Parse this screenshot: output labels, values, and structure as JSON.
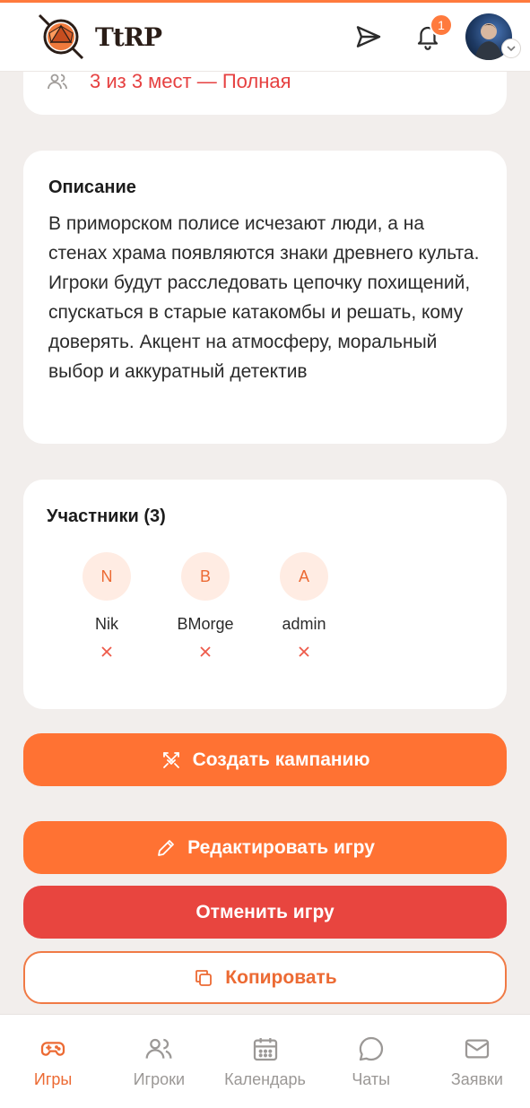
{
  "header": {
    "logo_text": "TtRP",
    "notifications_count": "1"
  },
  "seats": {
    "text": "3 из 3 мест — Полная"
  },
  "description": {
    "title": "Описание",
    "text": "В приморском полисе исчезают люди, а на стенах храма появляются знаки древнего культа. Игроки будут расследовать цепочку похищений, спускаться в старые катакомбы и решать, кому доверять. Акцент на атмосферу, моральный выбор и аккуратный детектив"
  },
  "participants": {
    "title": "Участники (3)",
    "members": [
      {
        "initial": "N",
        "name": "Nik"
      },
      {
        "initial": "B",
        "name": "BMorge"
      },
      {
        "initial": "A",
        "name": "admin"
      }
    ]
  },
  "actions": {
    "create_campaign": "Создать кампанию",
    "edit_game": "Редактировать игру",
    "cancel_game": "Отменить игру",
    "copy": "Копировать"
  },
  "bottom_nav": {
    "items": [
      {
        "label": "Игры",
        "icon": "gamepad-icon",
        "active": true
      },
      {
        "label": "Игроки",
        "icon": "users-icon",
        "active": false
      },
      {
        "label": "Календарь",
        "icon": "calendar-icon",
        "active": false
      },
      {
        "label": "Чаты",
        "icon": "chat-icon",
        "active": false
      },
      {
        "label": "Заявки",
        "icon": "mail-icon",
        "active": false
      }
    ]
  },
  "colors": {
    "accent": "#ff7233",
    "danger": "#e8453f",
    "background": "#f2eeec"
  }
}
